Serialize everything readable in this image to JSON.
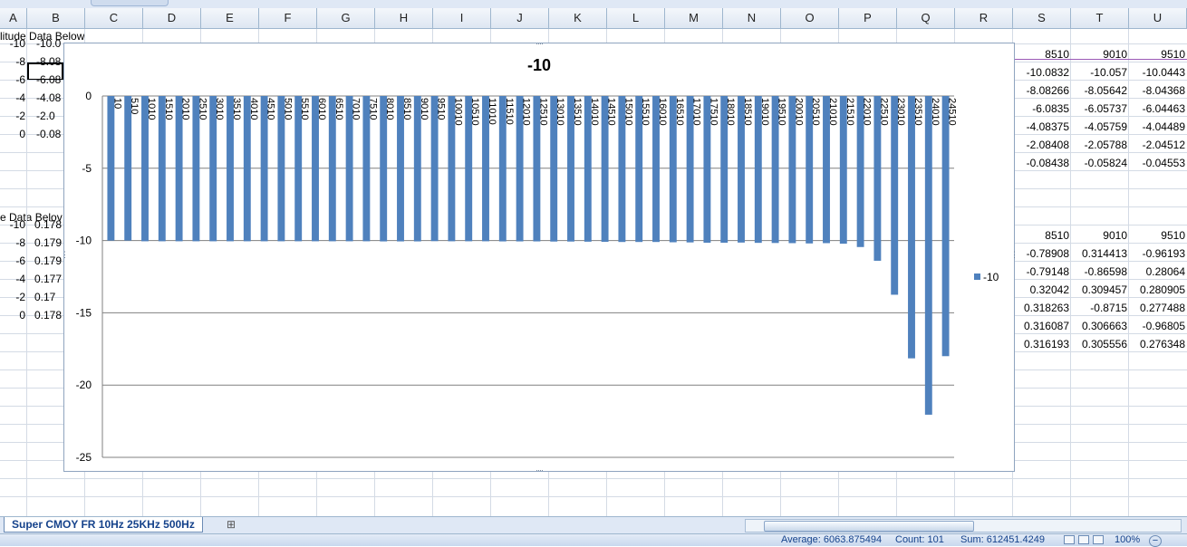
{
  "columns": [
    "A",
    "B",
    "C",
    "D",
    "E",
    "F",
    "G",
    "H",
    "I",
    "J",
    "K",
    "L",
    "M",
    "N",
    "O",
    "P",
    "Q",
    "R",
    "S",
    "T",
    "U"
  ],
  "sheet_text": {
    "a1": "litude Data Below",
    "a9": "e Data Belov"
  },
  "col_a": [
    "-10",
    "-8",
    "-6",
    "-4",
    "-2",
    "0",
    "-10",
    "-8",
    "-6",
    "-4",
    "-2",
    "0"
  ],
  "col_b": [
    "-10.0",
    "-8.08",
    "-6.08",
    "-4.08",
    "-2.0",
    "-0.08",
    "0.178",
    "0.179",
    "0.179",
    "0.177",
    "0.17",
    "0.178"
  ],
  "right_table_1": {
    "header": [
      "8510",
      "9010",
      "9510"
    ],
    "rows": [
      [
        "-10.0832",
        "-10.057",
        "-10.0443"
      ],
      [
        "-8.08266",
        "-8.05642",
        "-8.04368"
      ],
      [
        "-6.0835",
        "-6.05737",
        "-6.04463"
      ],
      [
        "-4.08375",
        "-4.05759",
        "-4.04489"
      ],
      [
        "-2.08408",
        "-2.05788",
        "-2.04512"
      ],
      [
        "-0.08438",
        "-0.05824",
        "-0.04553"
      ]
    ]
  },
  "right_table_2": {
    "header": [
      "8510",
      "9010",
      "9510"
    ],
    "rows": [
      [
        "-0.78908",
        "0.314413",
        "-0.96193"
      ],
      [
        "-0.79148",
        "-0.86598",
        "0.28064"
      ],
      [
        "0.32042",
        "0.309457",
        "0.280905"
      ],
      [
        "0.318263",
        "-0.8715",
        "0.277488"
      ],
      [
        "0.316087",
        "0.306663",
        "-0.96805"
      ],
      [
        "0.316193",
        "0.305556",
        "0.276348"
      ]
    ]
  },
  "chart_data": {
    "type": "bar",
    "title": "-10",
    "categories": [
      "10",
      "510",
      "1010",
      "1510",
      "2010",
      "2510",
      "3010",
      "3510",
      "4010",
      "4510",
      "5010",
      "5510",
      "6010",
      "6510",
      "7010",
      "7510",
      "8010",
      "8510",
      "9010",
      "9510",
      "10010",
      "10510",
      "11010",
      "11510",
      "12010",
      "12510",
      "13010",
      "13510",
      "14010",
      "14510",
      "15010",
      "15510",
      "16010",
      "16510",
      "17010",
      "17510",
      "18010",
      "18510",
      "19010",
      "19510",
      "20010",
      "20510",
      "21010",
      "21510",
      "22010",
      "22510",
      "23010",
      "23510",
      "24010",
      "24510"
    ],
    "series": [
      {
        "name": "-10",
        "color": "#4f81bd",
        "values": [
          -10.0,
          -10.0,
          -10.05,
          -10.05,
          -10.05,
          -10.05,
          -10.05,
          -10.05,
          -10.05,
          -10.05,
          -10.05,
          -10.05,
          -10.05,
          -10.05,
          -10.05,
          -10.05,
          -10.06,
          -10.06,
          -10.06,
          -10.04,
          -10.05,
          -10.05,
          -10.05,
          -10.06,
          -10.06,
          -10.06,
          -10.07,
          -10.07,
          -10.08,
          -10.09,
          -10.1,
          -10.1,
          -10.1,
          -10.12,
          -10.13,
          -10.15,
          -10.15,
          -10.14,
          -10.16,
          -10.17,
          -10.18,
          -10.2,
          -10.18,
          -10.22,
          -10.45,
          -11.4,
          -13.75,
          -18.15,
          -22.05,
          -18.0
        ]
      }
    ],
    "ylim": [
      -25,
      0
    ],
    "yticks": [
      "0",
      "-5",
      "-10",
      "-15",
      "-20",
      "-25"
    ],
    "grid": true,
    "legend": "right"
  },
  "sheet_tab": "Super CMOY FR 10Hz 25KHz 500Hz",
  "status": {
    "average": "Average: 6063.875494",
    "count": "Count: 101",
    "sum": "Sum: 612451.4249",
    "zoom": "100%"
  }
}
